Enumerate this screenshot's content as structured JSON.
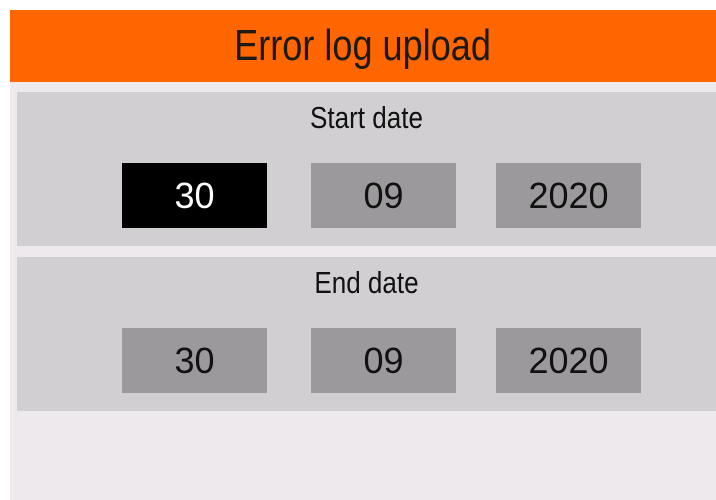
{
  "title": "Error log upload",
  "start_date": {
    "label": "Start date",
    "day": "30",
    "month": "09",
    "year": "2020"
  },
  "end_date": {
    "label": "End date",
    "day": "30",
    "month": "09",
    "year": "2020"
  },
  "colors": {
    "header": "#ff6600",
    "background": "#ede9ec",
    "panel": "#d1cfd2",
    "field": "#9b999b",
    "selected_field": "#000000"
  }
}
